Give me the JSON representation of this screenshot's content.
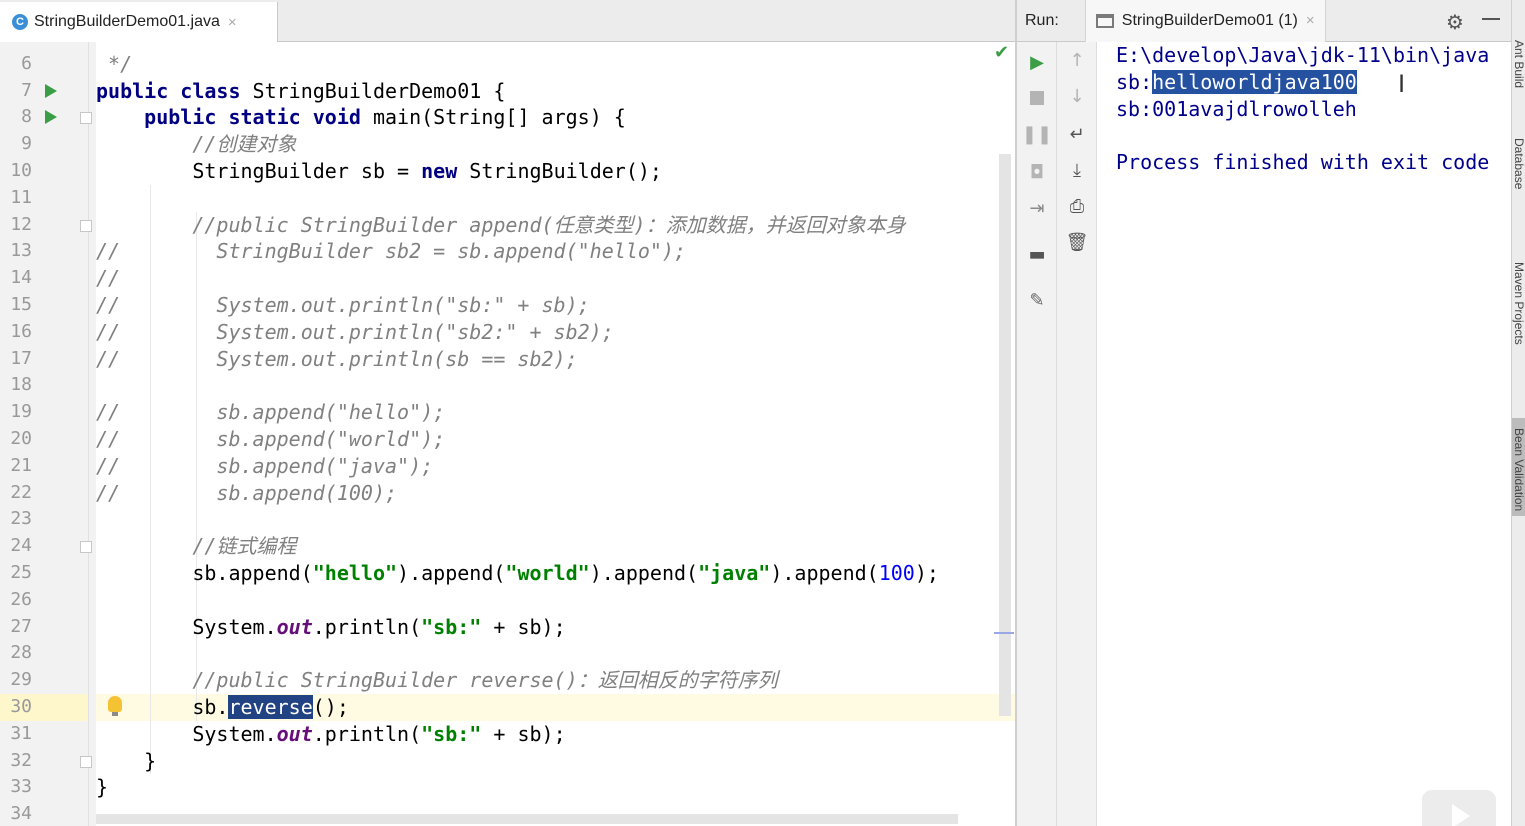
{
  "editor_tab": {
    "icon": "C",
    "filename": "StringBuilderDemo01.java",
    "close": "×"
  },
  "editor_lines": [
    {
      "n": "6",
      "segments": [
        {
          "t": " */",
          "c": "cm"
        }
      ]
    },
    {
      "n": "7",
      "segments": [
        {
          "t": "public class ",
          "c": "kw"
        },
        {
          "t": "StringBuilderDemo01 {",
          "c": ""
        }
      ]
    },
    {
      "n": "8",
      "segments": [
        {
          "t": "    "
        },
        {
          "t": "public static void ",
          "c": "kw"
        },
        {
          "t": "main(String[] args) {",
          "c": ""
        }
      ]
    },
    {
      "n": "9",
      "segments": [
        {
          "t": "        "
        },
        {
          "t": "//创建对象",
          "c": "cm"
        }
      ]
    },
    {
      "n": "10",
      "segments": [
        {
          "t": "        StringBuilder sb = "
        },
        {
          "t": "new ",
          "c": "kw"
        },
        {
          "t": "StringBuilder();"
        }
      ]
    },
    {
      "n": "11",
      "segments": []
    },
    {
      "n": "12",
      "segments": [
        {
          "t": "        "
        },
        {
          "t": "//public StringBuilder append(任意类型)：添加数据，并返回对象本身",
          "c": "cm"
        }
      ]
    },
    {
      "n": "13",
      "segments": [
        {
          "t": "//        StringBuilder sb2 = sb.append(\"hello\");",
          "c": "cm"
        }
      ]
    },
    {
      "n": "14",
      "segments": [
        {
          "t": "//",
          "c": "cm"
        }
      ]
    },
    {
      "n": "15",
      "segments": [
        {
          "t": "//        System.out.println(\"sb:\" + sb);",
          "c": "cm"
        }
      ]
    },
    {
      "n": "16",
      "segments": [
        {
          "t": "//        System.out.println(\"sb2:\" + sb2);",
          "c": "cm"
        }
      ]
    },
    {
      "n": "17",
      "segments": [
        {
          "t": "//        System.out.println(sb == sb2);",
          "c": "cm"
        }
      ]
    },
    {
      "n": "18",
      "segments": []
    },
    {
      "n": "19",
      "segments": [
        {
          "t": "//        sb.append(\"hello\");",
          "c": "cm"
        }
      ]
    },
    {
      "n": "20",
      "segments": [
        {
          "t": "//        sb.append(\"world\");",
          "c": "cm"
        }
      ]
    },
    {
      "n": "21",
      "segments": [
        {
          "t": "//        sb.append(\"java\");",
          "c": "cm"
        }
      ]
    },
    {
      "n": "22",
      "segments": [
        {
          "t": "//        sb.append(100);",
          "c": "cm"
        }
      ]
    },
    {
      "n": "23",
      "segments": []
    },
    {
      "n": "24",
      "segments": [
        {
          "t": "        "
        },
        {
          "t": "//链式编程",
          "c": "cm"
        }
      ]
    },
    {
      "n": "25",
      "segments": [
        {
          "t": "        sb.append("
        },
        {
          "t": "\"hello\"",
          "c": "str"
        },
        {
          "t": ").append("
        },
        {
          "t": "\"world\"",
          "c": "str"
        },
        {
          "t": ").append("
        },
        {
          "t": "\"java\"",
          "c": "str"
        },
        {
          "t": ").append("
        },
        {
          "t": "100",
          "c": "num"
        },
        {
          "t": ");"
        }
      ]
    },
    {
      "n": "26",
      "segments": []
    },
    {
      "n": "27",
      "segments": [
        {
          "t": "        System."
        },
        {
          "t": "out",
          "c": "fld"
        },
        {
          "t": ".println("
        },
        {
          "t": "\"sb:\"",
          "c": "str"
        },
        {
          "t": " + sb);"
        }
      ]
    },
    {
      "n": "28",
      "segments": []
    },
    {
      "n": "29",
      "segments": [
        {
          "t": "        "
        },
        {
          "t": "//public StringBuilder reverse()：返回相反的字符序列",
          "c": "cm"
        }
      ]
    },
    {
      "n": "30",
      "segments": [
        {
          "t": "        sb."
        },
        {
          "t": "reverse",
          "c": "sel"
        },
        {
          "t": "();"
        }
      ]
    },
    {
      "n": "31",
      "segments": [
        {
          "t": "        System."
        },
        {
          "t": "out",
          "c": "fld"
        },
        {
          "t": ".println("
        },
        {
          "t": "\"sb:\"",
          "c": "str"
        },
        {
          "t": " + sb);"
        }
      ]
    },
    {
      "n": "32",
      "segments": [
        {
          "t": "    }"
        }
      ]
    },
    {
      "n": "33",
      "segments": [
        {
          "t": "}"
        }
      ]
    },
    {
      "n": "34",
      "segments": []
    }
  ],
  "run_panel": {
    "label": "Run:",
    "tab_name": "StringBuilderDemo01 (1)",
    "close": "×",
    "output": [
      [
        {
          "t": "E:\\develop\\Java\\jdk-11\\bin\\java"
        }
      ],
      [
        {
          "t": "sb:"
        },
        {
          "t": "helloworldjava100",
          "c": "sel2"
        }
      ],
      [
        {
          "t": "sb:001avajdlrowolleh"
        }
      ],
      [],
      [
        {
          "t": "Process finished with exit code"
        }
      ]
    ]
  },
  "right_strip": [
    "Ant Build",
    "Database",
    "Maven Projects",
    "Bean Validation"
  ],
  "icons": {
    "toolbar1": [
      "rerun-icon",
      "stop-icon",
      "pause-icon",
      "camera-icon",
      "restore-layout-icon",
      "layout-icon",
      "pin-icon"
    ],
    "toolbar2": [
      "up-arrow-icon",
      "down-arrow-icon",
      "soft-wrap-icon",
      "scroll-to-end-icon",
      "print-icon",
      "trash-icon"
    ]
  }
}
